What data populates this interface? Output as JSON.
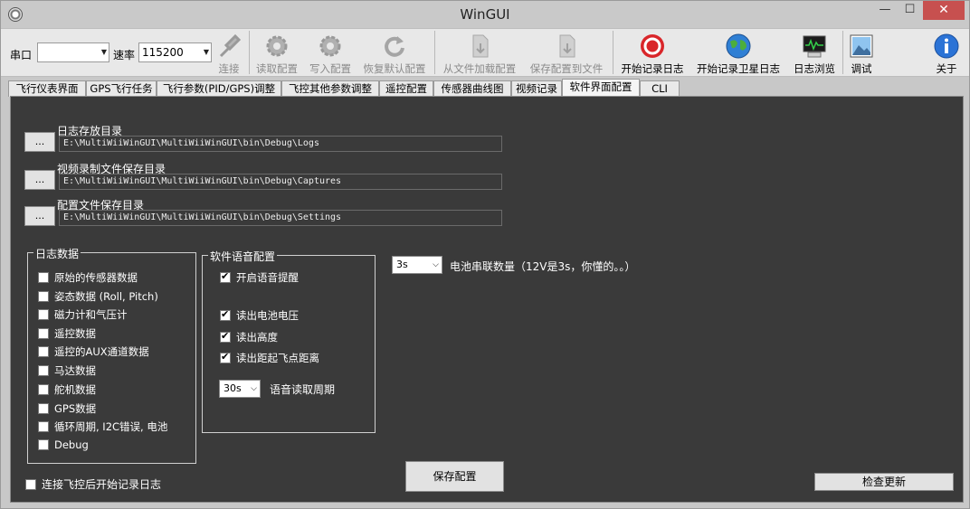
{
  "window": {
    "title": "WinGUI",
    "minimize": "—",
    "maximize": "☐",
    "close": "✕"
  },
  "toolbar": {
    "port_label": "串口",
    "port_value": "",
    "baud_label": "速率",
    "baud_value": "115200",
    "buttons": [
      {
        "label": "连接",
        "icon": "plug-icon",
        "enabled": false
      },
      {
        "label": "读取配置",
        "icon": "gear-icon",
        "enabled": false
      },
      {
        "label": "写入配置",
        "icon": "gear-icon",
        "enabled": false
      },
      {
        "label": "恢复默认配置",
        "icon": "reset-icon",
        "enabled": false
      },
      {
        "label": "从文件加载配置",
        "icon": "file-load-icon",
        "enabled": false
      },
      {
        "label": "保存配置到文件",
        "icon": "file-save-icon",
        "enabled": false
      },
      {
        "label": "开始记录日志",
        "icon": "record-icon",
        "enabled": true
      },
      {
        "label": "开始记录卫星日志",
        "icon": "globe-icon",
        "enabled": true
      },
      {
        "label": "日志浏览",
        "icon": "monitor-icon",
        "enabled": true
      },
      {
        "label": "调试",
        "icon": "picture-icon",
        "enabled": true
      },
      {
        "label": "关于",
        "icon": "info-icon",
        "enabled": true
      }
    ]
  },
  "tabs": [
    {
      "label": "飞行仪表界面",
      "active": false
    },
    {
      "label": "GPS飞行任务",
      "active": false
    },
    {
      "label": "飞行参数(PID/GPS)调整",
      "active": false
    },
    {
      "label": "飞控其他参数调整",
      "active": false
    },
    {
      "label": "遥控配置",
      "active": false
    },
    {
      "label": "传感器曲线图",
      "active": false
    },
    {
      "label": "视频记录",
      "active": false
    },
    {
      "label": "软件界面配置",
      "active": true
    },
    {
      "label": "CLI",
      "active": false
    }
  ],
  "directories": [
    {
      "label": "日志存放目录",
      "button": "...",
      "path": "E:\\MultiWiiWinGUI\\MultiWiiWinGUI\\bin\\Debug\\Logs"
    },
    {
      "label": "视频录制文件保存目录",
      "button": "...",
      "path": "E:\\MultiWiiWinGUI\\MultiWiiWinGUI\\bin\\Debug\\Captures"
    },
    {
      "label": "配置文件保存目录",
      "button": "...",
      "path": "E:\\MultiWiiWinGUI\\MultiWiiWinGUI\\bin\\Debug\\Settings"
    }
  ],
  "log_data": {
    "title": "日志数据",
    "items": [
      {
        "label": "原始的传感器数据",
        "checked": false
      },
      {
        "label": "姿态数据 (Roll, Pitch)",
        "checked": false
      },
      {
        "label": "磁力计和气压计",
        "checked": false
      },
      {
        "label": "遥控数据",
        "checked": false
      },
      {
        "label": "遥控的AUX通道数据",
        "checked": false
      },
      {
        "label": "马达数据",
        "checked": false
      },
      {
        "label": "舵机数据",
        "checked": false
      },
      {
        "label": "GPS数据",
        "checked": false
      },
      {
        "label": "循环周期, I2C错误, 电池",
        "checked": false
      },
      {
        "label": "Debug",
        "checked": false
      }
    ]
  },
  "voice": {
    "title": "软件语音配置",
    "enable": {
      "label": "开启语音提醒",
      "checked": true
    },
    "items": [
      {
        "label": "读出电池电压",
        "checked": true
      },
      {
        "label": "读出高度",
        "checked": true
      },
      {
        "label": "读出距起飞点距离",
        "checked": true
      }
    ],
    "period_value": "30s",
    "period_label": "语音读取周期"
  },
  "battery": {
    "value": "3s",
    "label": "电池串联数量（12V是3s，你懂的。。）"
  },
  "auto_log": {
    "label": "连接飞控后开始记录日志",
    "checked": false
  },
  "save_button": "保存配置",
  "update_button": "检查更新"
}
